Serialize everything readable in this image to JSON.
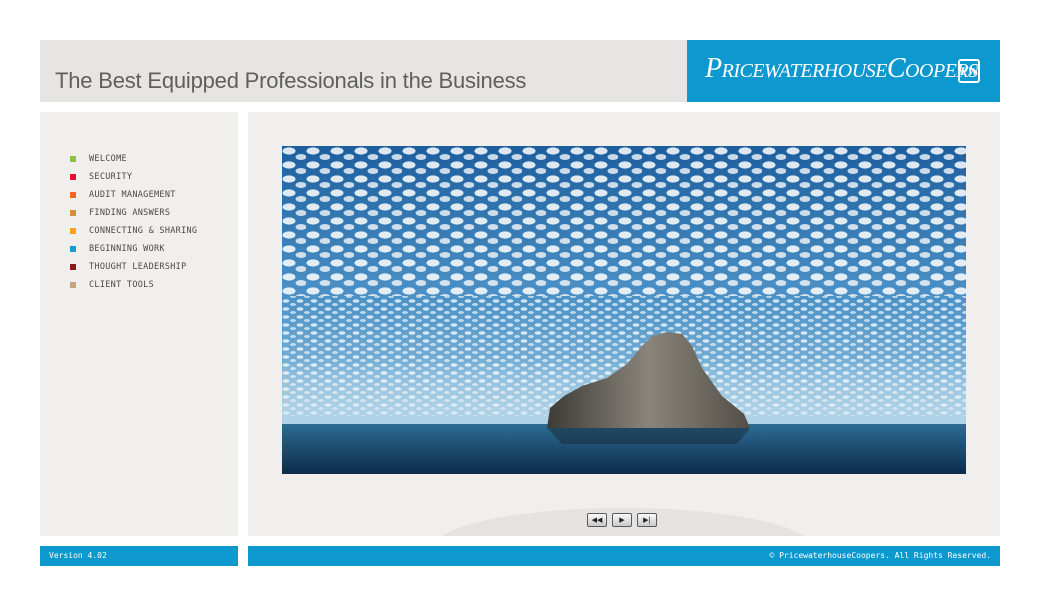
{
  "header": {
    "title": "The Best Equipped Professionals in the Business",
    "logo_text": "PricewaterhouseCoopers",
    "logo_mark": "PW"
  },
  "sidebar": {
    "items": [
      {
        "label": "WELCOME",
        "color": "#8cc63f"
      },
      {
        "label": "SECURITY",
        "color": "#e8112d"
      },
      {
        "label": "AUDIT MANAGEMENT",
        "color": "#f26722"
      },
      {
        "label": "FINDING ANSWERS",
        "color": "#d4913a"
      },
      {
        "label": "CONNECTING & SHARING",
        "color": "#f7a21b"
      },
      {
        "label": "BEGINNING WORK",
        "color": "#1a9ad6"
      },
      {
        "label": "THOUGHT LEADERSHIP",
        "color": "#8b1a1a"
      },
      {
        "label": "CLIENT TOOLS",
        "color": "#c2a67a"
      }
    ]
  },
  "main": {
    "image": "sky-clouds-rock-island",
    "controls": {
      "rewind_icon": "rewind-icon",
      "play_icon": "play-icon",
      "forward_icon": "step-forward-icon"
    }
  },
  "footer": {
    "version": "Version 4.02",
    "copyright": "© PricewaterhouseCoopers. All Rights Reserved."
  },
  "colors": {
    "brand_blue": "#0d98cf",
    "panel_bg": "#f0efed",
    "header_bg": "#e6e5e3"
  }
}
